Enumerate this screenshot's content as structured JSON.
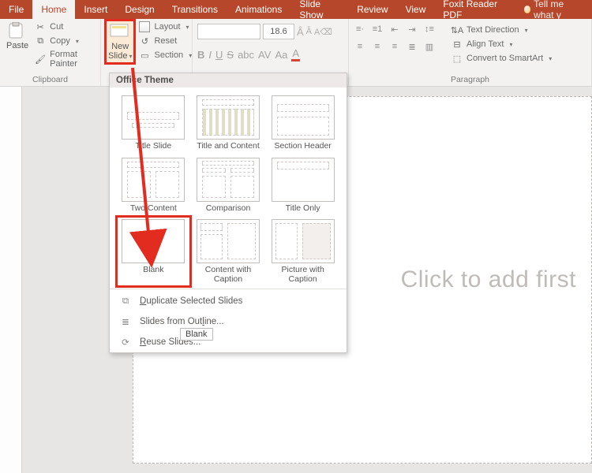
{
  "tabs": {
    "file": "File",
    "home": "Home",
    "insert": "Insert",
    "design": "Design",
    "transitions": "Transitions",
    "animations": "Animations",
    "slide_show": "Slide Show",
    "review": "Review",
    "view": "View",
    "foxit": "Foxit Reader PDF",
    "tell_me": "Tell me what y"
  },
  "clipboard": {
    "paste": "Paste",
    "cut": "Cut",
    "copy": "Copy",
    "format_painter": "Format Painter",
    "group": "Clipboard"
  },
  "slides": {
    "new_slide": "New\nSlide",
    "layout": "Layout",
    "reset": "Reset",
    "section": "Section"
  },
  "font": {
    "size": "18.6",
    "group": "",
    "bold": "B",
    "italic": "I",
    "underline": "U",
    "strike": "S",
    "aa_inc": "A",
    "aa_dec": "A"
  },
  "paragraph": {
    "group": "Paragraph",
    "text_dir": "Text Direction",
    "align_text": "Align Text",
    "smartart": "Convert to SmartArt"
  },
  "gallery": {
    "heading": "Office Theme",
    "layouts": [
      "Title Slide",
      "Title and Content",
      "Section Header",
      "Two Content",
      "Comparison",
      "Title Only",
      "Blank",
      "Content with Caption",
      "Picture with Caption"
    ],
    "dup": "Duplicate Selected Slides",
    "outline": "Slides from Outline...",
    "reuse": "Reuse Slides..."
  },
  "tooltip": "Blank",
  "canvas_placeholder": "Click to add first"
}
